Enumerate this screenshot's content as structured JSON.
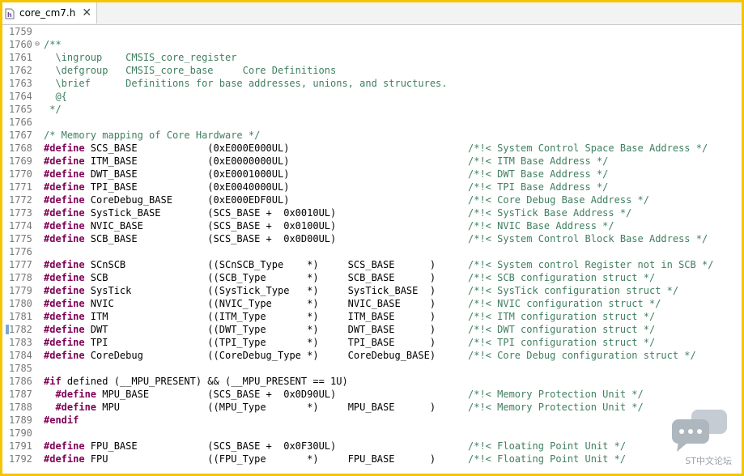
{
  "tab": {
    "title": "core_cm7.h",
    "close": "✕",
    "icon": "c-header-file-icon"
  },
  "watermark": {
    "text": "ST中文论坛",
    "icon": "chat-bubble-icon"
  },
  "lines": [
    {
      "n": "1759",
      "code": "",
      "comment": ""
    },
    {
      "n": "1760",
      "fold": "⊖",
      "code": "/**",
      "comment": ""
    },
    {
      "n": "1761",
      "code": "",
      "comment": "  \\ingroup    CMSIS_core_register"
    },
    {
      "n": "1762",
      "code": "",
      "comment": "  \\defgroup   CMSIS_core_base     Core Definitions"
    },
    {
      "n": "1763",
      "code": "",
      "comment": "  \\brief      Definitions for base addresses, unions, and structures."
    },
    {
      "n": "1764",
      "code": "",
      "comment": "  @{"
    },
    {
      "n": "1765",
      "code": "",
      "comment": " */"
    },
    {
      "n": "1766",
      "code": "",
      "comment": ""
    },
    {
      "n": "1767",
      "code": "",
      "comment": "/* Memory mapping of Core Hardware */"
    },
    {
      "n": "1768",
      "kw": "#define",
      "code": " SCS_BASE            (0xE000E000UL)",
      "comment": "/*!< System Control Space Base Address */"
    },
    {
      "n": "1769",
      "kw": "#define",
      "code": " ITM_BASE            (0xE0000000UL)",
      "comment": "/*!< ITM Base Address */"
    },
    {
      "n": "1770",
      "kw": "#define",
      "code": " DWT_BASE            (0xE0001000UL)",
      "comment": "/*!< DWT Base Address */"
    },
    {
      "n": "1771",
      "kw": "#define",
      "code": " TPI_BASE            (0xE0040000UL)",
      "comment": "/*!< TPI Base Address */"
    },
    {
      "n": "1772",
      "kw": "#define",
      "code": " CoreDebug_BASE      (0xE000EDF0UL)",
      "comment": "/*!< Core Debug Base Address */"
    },
    {
      "n": "1773",
      "kw": "#define",
      "code": " SysTick_BASE        (SCS_BASE +  0x0010UL)",
      "comment": "/*!< SysTick Base Address */"
    },
    {
      "n": "1774",
      "kw": "#define",
      "code": " NVIC_BASE           (SCS_BASE +  0x0100UL)",
      "comment": "/*!< NVIC Base Address */"
    },
    {
      "n": "1775",
      "kw": "#define",
      "code": " SCB_BASE            (SCS_BASE +  0x0D00UL)",
      "comment": "/*!< System Control Block Base Address */"
    },
    {
      "n": "1776",
      "code": "",
      "comment": ""
    },
    {
      "n": "1777",
      "kw": "#define",
      "code": " SCnSCB              ((SCnSCB_Type    *)     SCS_BASE      )",
      "comment": "/*!< System control Register not in SCB */"
    },
    {
      "n": "1778",
      "kw": "#define",
      "code": " SCB                 ((SCB_Type       *)     SCB_BASE      )",
      "comment": "/*!< SCB configuration struct */"
    },
    {
      "n": "1779",
      "kw": "#define",
      "code": " SysTick             ((SysTick_Type   *)     SysTick_BASE  )",
      "comment": "/*!< SysTick configuration struct */"
    },
    {
      "n": "1780",
      "kw": "#define",
      "code": " NVIC                ((NVIC_Type      *)     NVIC_BASE     )",
      "comment": "/*!< NVIC configuration struct */"
    },
    {
      "n": "1781",
      "kw": "#define",
      "code": " ITM                 ((ITM_Type       *)     ITM_BASE      )",
      "comment": "/*!< ITM configuration struct */"
    },
    {
      "n": "1782",
      "kw": "#define",
      "code": " DWT                 ((DWT_Type       *)     DWT_BASE      )",
      "comment": "/*!< DWT configuration struct */",
      "marker": true
    },
    {
      "n": "1783",
      "kw": "#define",
      "code": " TPI                 ((TPI_Type       *)     TPI_BASE      )",
      "comment": "/*!< TPI configuration struct */"
    },
    {
      "n": "1784",
      "kw": "#define",
      "code": " CoreDebug           ((CoreDebug_Type *)     CoreDebug_BASE)",
      "comment": "/*!< Core Debug configuration struct */"
    },
    {
      "n": "1785",
      "code": "",
      "comment": ""
    },
    {
      "n": "1786",
      "kw": "#if",
      "code": " defined (__MPU_PRESENT) && (__MPU_PRESENT == 1U)",
      "comment": ""
    },
    {
      "n": "1787",
      "pre": "  ",
      "kw": "#define",
      "code": " MPU_BASE          (SCS_BASE +  0x0D90UL)",
      "comment": "/*!< Memory Protection Unit */"
    },
    {
      "n": "1788",
      "pre": "  ",
      "kw": "#define",
      "code": " MPU               ((MPU_Type       *)     MPU_BASE      )",
      "comment": "/*!< Memory Protection Unit */"
    },
    {
      "n": "1789",
      "kw": "#endif",
      "code": "",
      "comment": ""
    },
    {
      "n": "1790",
      "code": "",
      "comment": ""
    },
    {
      "n": "1791",
      "kw": "#define",
      "code": " FPU_BASE            (SCS_BASE +  0x0F30UL)",
      "comment": "/*!< Floating Point Unit */"
    },
    {
      "n": "1792",
      "kw": "#define",
      "code": " FPU                 ((FPU_Type       *)     FPU_BASE      )",
      "comment": "/*!< Floating Point Unit */"
    }
  ]
}
